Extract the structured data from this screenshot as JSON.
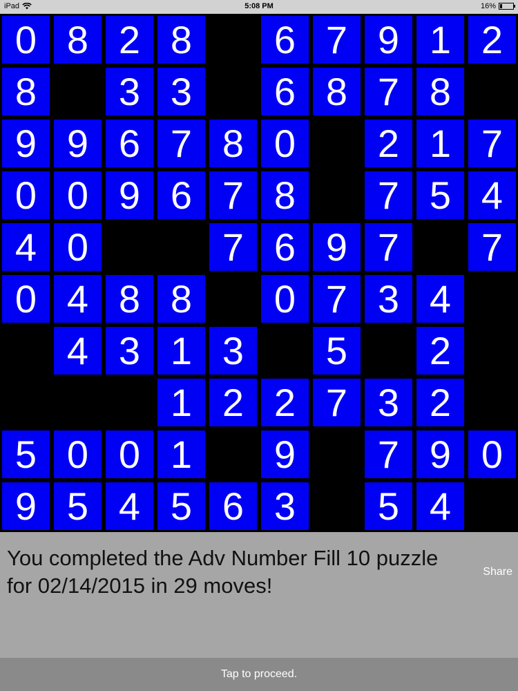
{
  "status_bar": {
    "device": "iPad",
    "time": "5:08 PM",
    "battery_percent": "16%",
    "battery_level": 0.16
  },
  "board": {
    "tile_color": "#0000f5",
    "rows": [
      [
        "0",
        "8",
        "2",
        "8",
        "",
        "6",
        "7",
        "9",
        "1",
        "2"
      ],
      [
        "8",
        "",
        "3",
        "3",
        "",
        "6",
        "8",
        "7",
        "8",
        ""
      ],
      [
        "9",
        "9",
        "6",
        "7",
        "8",
        "0",
        "",
        "2",
        "1",
        "7"
      ],
      [
        "0",
        "0",
        "9",
        "6",
        "7",
        "8",
        "",
        "7",
        "5",
        "4"
      ],
      [
        "4",
        "0",
        "",
        "",
        "7",
        "6",
        "9",
        "7",
        "",
        "7"
      ],
      [
        "0",
        "4",
        "8",
        "8",
        "",
        "0",
        "7",
        "3",
        "4",
        ""
      ],
      [
        "",
        "4",
        "3",
        "1",
        "3",
        "",
        "5",
        "",
        "2",
        ""
      ],
      [
        "",
        "",
        "",
        "1",
        "2",
        "2",
        "7",
        "3",
        "2",
        ""
      ],
      [
        "5",
        "0",
        "0",
        "1",
        "",
        "9",
        "",
        "7",
        "9",
        "0"
      ],
      [
        "9",
        "5",
        "4",
        "5",
        "6",
        "3",
        "",
        "5",
        "4",
        ""
      ]
    ]
  },
  "message": {
    "text": "You completed the Adv Number Fill 10 puzzle for 02/14/2015 in 29 moves!",
    "share_label": "Share"
  },
  "proceed": {
    "label": "Tap to proceed."
  }
}
